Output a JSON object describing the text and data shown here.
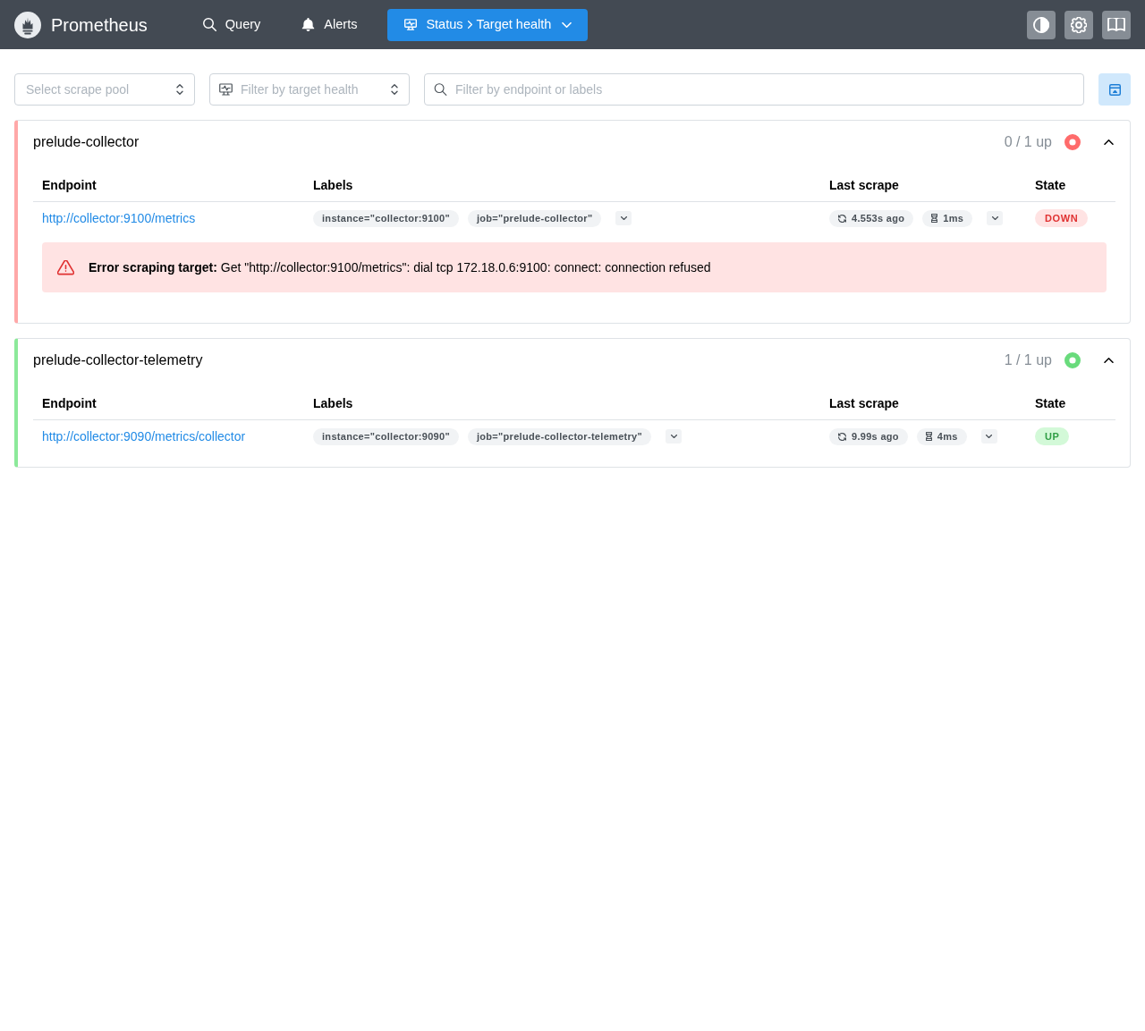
{
  "navbar": {
    "brand": "Prometheus",
    "links": [
      {
        "label": "Query",
        "selected": false
      },
      {
        "label": "Alerts",
        "selected": false
      },
      {
        "label": "Status",
        "page": "Target health",
        "selected": true
      }
    ]
  },
  "filters": {
    "scrape_pool": {
      "placeholder": "Select scrape pool"
    },
    "target_health": {
      "placeholder": "Filter by target health"
    },
    "search": {
      "placeholder": "Filter by endpoint or labels"
    }
  },
  "pools": [
    {
      "name": "prelude-collector",
      "summary": "0 / 1 up",
      "up": false,
      "expanded": true,
      "columns": [
        "Endpoint",
        "Labels",
        "Last scrape",
        "State"
      ],
      "targets": [
        {
          "endpoint": "http://collector:9100/metrics",
          "labels": [
            "instance=\"collector:9100\"",
            "job=\"prelude-collector\""
          ],
          "last_scrape": "4.553s ago",
          "duration": "1ms",
          "state": "DOWN",
          "up": false,
          "error": "**Error scraping target:** Get \"http://collector:9100/metrics\": dial tcp 172.18.0.6:9100: connect: connection refused"
        }
      ]
    },
    {
      "name": "prelude-collector-telemetry",
      "summary": "1 / 1 up",
      "up": true,
      "expanded": true,
      "columns": [
        "Endpoint",
        "Labels",
        "Last scrape",
        "State"
      ],
      "targets": [
        {
          "endpoint": "http://collector:9090/metrics/collector",
          "labels": [
            "instance=\"collector:9090\"",
            "job=\"prelude-collector-telemetry\""
          ],
          "last_scrape": "9.99s ago",
          "duration": "4ms",
          "state": "UP",
          "up": true
        }
      ]
    }
  ]
}
